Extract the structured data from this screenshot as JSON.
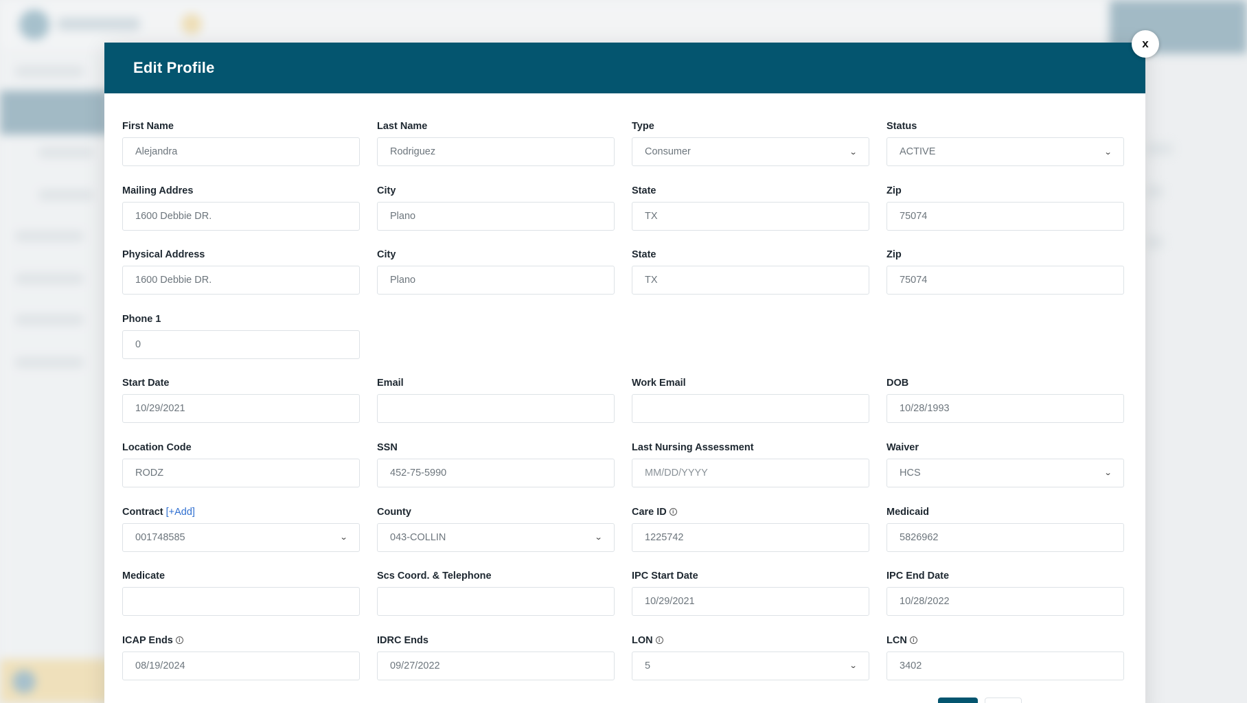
{
  "modal": {
    "title": "Edit Profile",
    "close_label": "x"
  },
  "fields": {
    "first_name": {
      "label": "First Name",
      "value": "Alejandra"
    },
    "last_name": {
      "label": "Last Name",
      "value": "Rodriguez"
    },
    "type": {
      "label": "Type",
      "value": "Consumer"
    },
    "status": {
      "label": "Status",
      "value": "ACTIVE"
    },
    "mailing_address": {
      "label": "Mailing Addres",
      "value": "1600 Debbie DR."
    },
    "mailing_city": {
      "label": "City",
      "value": "Plano"
    },
    "mailing_state": {
      "label": "State",
      "value": "TX"
    },
    "mailing_zip": {
      "label": "Zip",
      "value": "75074"
    },
    "physical_address": {
      "label": "Physical Address",
      "value": "1600 Debbie DR."
    },
    "physical_city": {
      "label": "City",
      "value": "Plano"
    },
    "physical_state": {
      "label": "State",
      "value": "TX"
    },
    "physical_zip": {
      "label": "Zip",
      "value": "75074"
    },
    "phone_1": {
      "label": "Phone 1",
      "value": "0"
    },
    "start_date": {
      "label": "Start Date",
      "value": "10/29/2021"
    },
    "email": {
      "label": "Email",
      "value": ""
    },
    "work_email": {
      "label": "Work Email",
      "value": ""
    },
    "dob": {
      "label": "DOB",
      "value": "10/28/1993"
    },
    "location_code": {
      "label": "Location Code",
      "value": "RODZ"
    },
    "ssn": {
      "label": "SSN",
      "value": "452-75-5990"
    },
    "last_nursing_assessment": {
      "label": "Last Nursing Assessment",
      "placeholder": "MM/DD/YYYY"
    },
    "waiver": {
      "label": "Waiver",
      "value": "HCS"
    },
    "contract": {
      "label": "Contract",
      "add_link": "[+Add]",
      "value": "001748585"
    },
    "county": {
      "label": "County",
      "value": "043-COLLIN"
    },
    "care_id": {
      "label": "Care ID",
      "value": "1225742"
    },
    "medicaid": {
      "label": "Medicaid",
      "value": "5826962"
    },
    "medicate": {
      "label": "Medicate",
      "value": ""
    },
    "scs_coord": {
      "label": "Scs Coord. & Telephone",
      "value": ""
    },
    "ipc_start_date": {
      "label": "IPC Start Date",
      "value": "10/29/2021"
    },
    "ipc_end_date": {
      "label": "IPC End Date",
      "value": "10/28/2022"
    },
    "icap_ends": {
      "label": "ICAP Ends",
      "value": "08/19/2024"
    },
    "idrc_ends": {
      "label": "IDRC Ends",
      "value": "09/27/2022"
    },
    "lon": {
      "label": "LON",
      "value": "5"
    },
    "lcn": {
      "label": "LCN",
      "value": "3402"
    }
  },
  "icons": {
    "info": "info-circle-icon",
    "chevron": "chevron-down-icon",
    "close": "close-icon"
  },
  "colors": {
    "header_bg": "#04556f",
    "link": "#2f6fd0"
  }
}
